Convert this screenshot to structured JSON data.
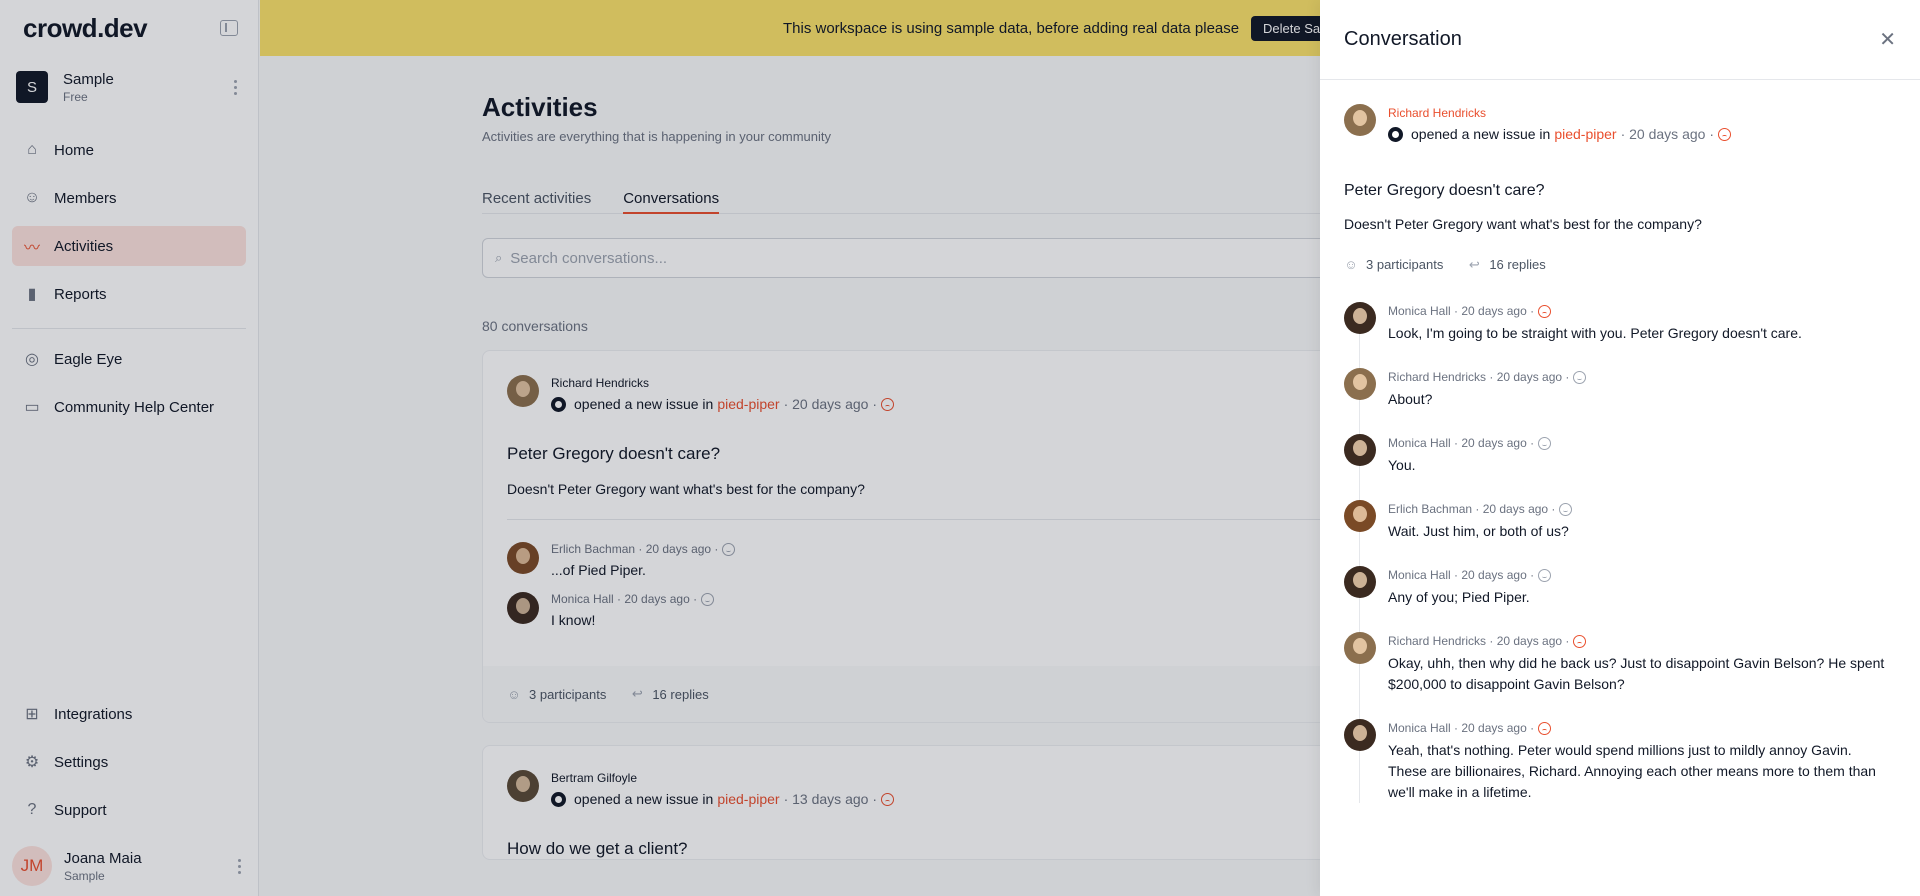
{
  "sidebar": {
    "logo": "crowd.dev",
    "workspace": {
      "initial": "S",
      "name": "Sample",
      "plan": "Free"
    },
    "nav": [
      {
        "label": "Home",
        "icon": "home-icon"
      },
      {
        "label": "Members",
        "icon": "users-icon"
      },
      {
        "label": "Activities",
        "icon": "activity-icon"
      },
      {
        "label": "Reports",
        "icon": "bar-chart-icon"
      }
    ],
    "nav2": [
      {
        "label": "Eagle Eye",
        "icon": "eagle-eye-icon"
      },
      {
        "label": "Community Help Center",
        "icon": "chat-icon"
      }
    ],
    "bottom_nav": [
      {
        "label": "Integrations",
        "icon": "grid-icon"
      },
      {
        "label": "Settings",
        "icon": "gear-icon"
      },
      {
        "label": "Support",
        "icon": "help-icon"
      }
    ],
    "user": {
      "initials": "JM",
      "name": "Joana Maia",
      "workspace": "Sample"
    }
  },
  "banner": {
    "text": "This workspace is using sample data, before adding real data please",
    "button": "Delete Sa"
  },
  "page": {
    "title": "Activities",
    "subtitle": "Activities are everything that is happening in your community",
    "tabs": [
      "Recent activities",
      "Conversations"
    ],
    "search_placeholder": "Search conversations...",
    "count": "80 conversations"
  },
  "cards": [
    {
      "author": "Richard Hendricks",
      "action": "opened a new issue in",
      "repo": "pied-piper",
      "time": "· 20 days ago ·",
      "title": "Peter Gregory doesn't care?",
      "text": "Doesn't Peter Gregory want what's best for the company?",
      "replies": [
        {
          "name": "Erlich Bachman · 20 days ago ·",
          "text": "...of Pied Piper."
        },
        {
          "name": "Monica Hall · 20 days ago ·",
          "text": "I know!"
        }
      ],
      "participants": "3 participants",
      "reply_count": "16 replies"
    },
    {
      "author": "Bertram Gilfoyle",
      "action": "opened a new issue in",
      "repo": "pied-piper",
      "time": "· 13 days ago ·",
      "title": "How do we get a client?"
    }
  ],
  "drawer": {
    "title": "Conversation",
    "author": "Richard Hendricks",
    "action": "opened a new issue in",
    "repo": "pied-piper",
    "time": "· 20 days ago ·",
    "subject": "Peter Gregory doesn't care?",
    "text": "Doesn't Peter Gregory want what's best for the company?",
    "participants": "3 participants",
    "replies": "16 replies",
    "thread": [
      {
        "name": "Monica Hall · 20 days ago ·",
        "text": "Look, I'm going to be straight with you. Peter Gregory doesn't care."
      },
      {
        "name": "Richard Hendricks · 20 days ago ·",
        "text": "About?"
      },
      {
        "name": "Monica Hall · 20 days ago ·",
        "text": "You."
      },
      {
        "name": "Erlich Bachman · 20 days ago ·",
        "text": "Wait. Just him, or both of us?"
      },
      {
        "name": "Monica Hall · 20 days ago ·",
        "text": "Any of you; Pied Piper."
      },
      {
        "name": "Richard Hendricks · 20 days ago ·",
        "text": "Okay, uhh, then why did he back us? Just to disappoint Gavin Belson? He spent $200,000 to disappoint Gavin Belson?"
      },
      {
        "name": "Monica Hall · 20 days ago ·",
        "text": "Yeah, that's nothing. Peter would spend millions just to mildly annoy Gavin. These are billionaires, Richard. Annoying each other means more to them than we'll make in a lifetime."
      }
    ]
  }
}
